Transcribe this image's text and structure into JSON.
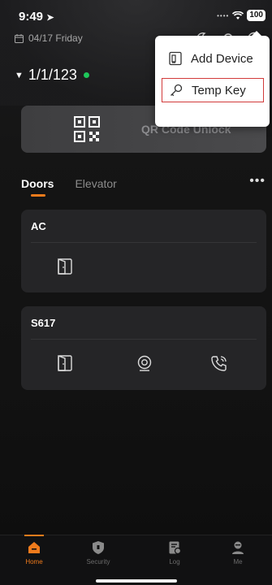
{
  "status_bar": {
    "time": "9:49",
    "battery": "100"
  },
  "header": {
    "date": "04/17 Friday",
    "location": "1/1/123"
  },
  "qr_card": {
    "label": "QR Code Unlock"
  },
  "tabs": [
    {
      "label": "Doors",
      "active": true
    },
    {
      "label": "Elevator",
      "active": false
    }
  ],
  "cards": [
    {
      "title": "AC"
    },
    {
      "title": "S617"
    }
  ],
  "dropdown": {
    "items": [
      {
        "label": "Add Device",
        "icon": "device-icon"
      },
      {
        "label": "Temp Key",
        "icon": "key-icon"
      }
    ]
  },
  "bottom_nav": [
    {
      "label": "Home",
      "icon": "home-icon",
      "active": true
    },
    {
      "label": "Security",
      "icon": "shield-icon",
      "active": false
    },
    {
      "label": "Log",
      "icon": "log-icon",
      "active": false
    },
    {
      "label": "Me",
      "icon": "user-icon",
      "active": false
    }
  ],
  "colors": {
    "accent": "#f07b1c",
    "online": "#1ec75a",
    "card": "#252527",
    "highlight_border": "#d23b3b"
  }
}
